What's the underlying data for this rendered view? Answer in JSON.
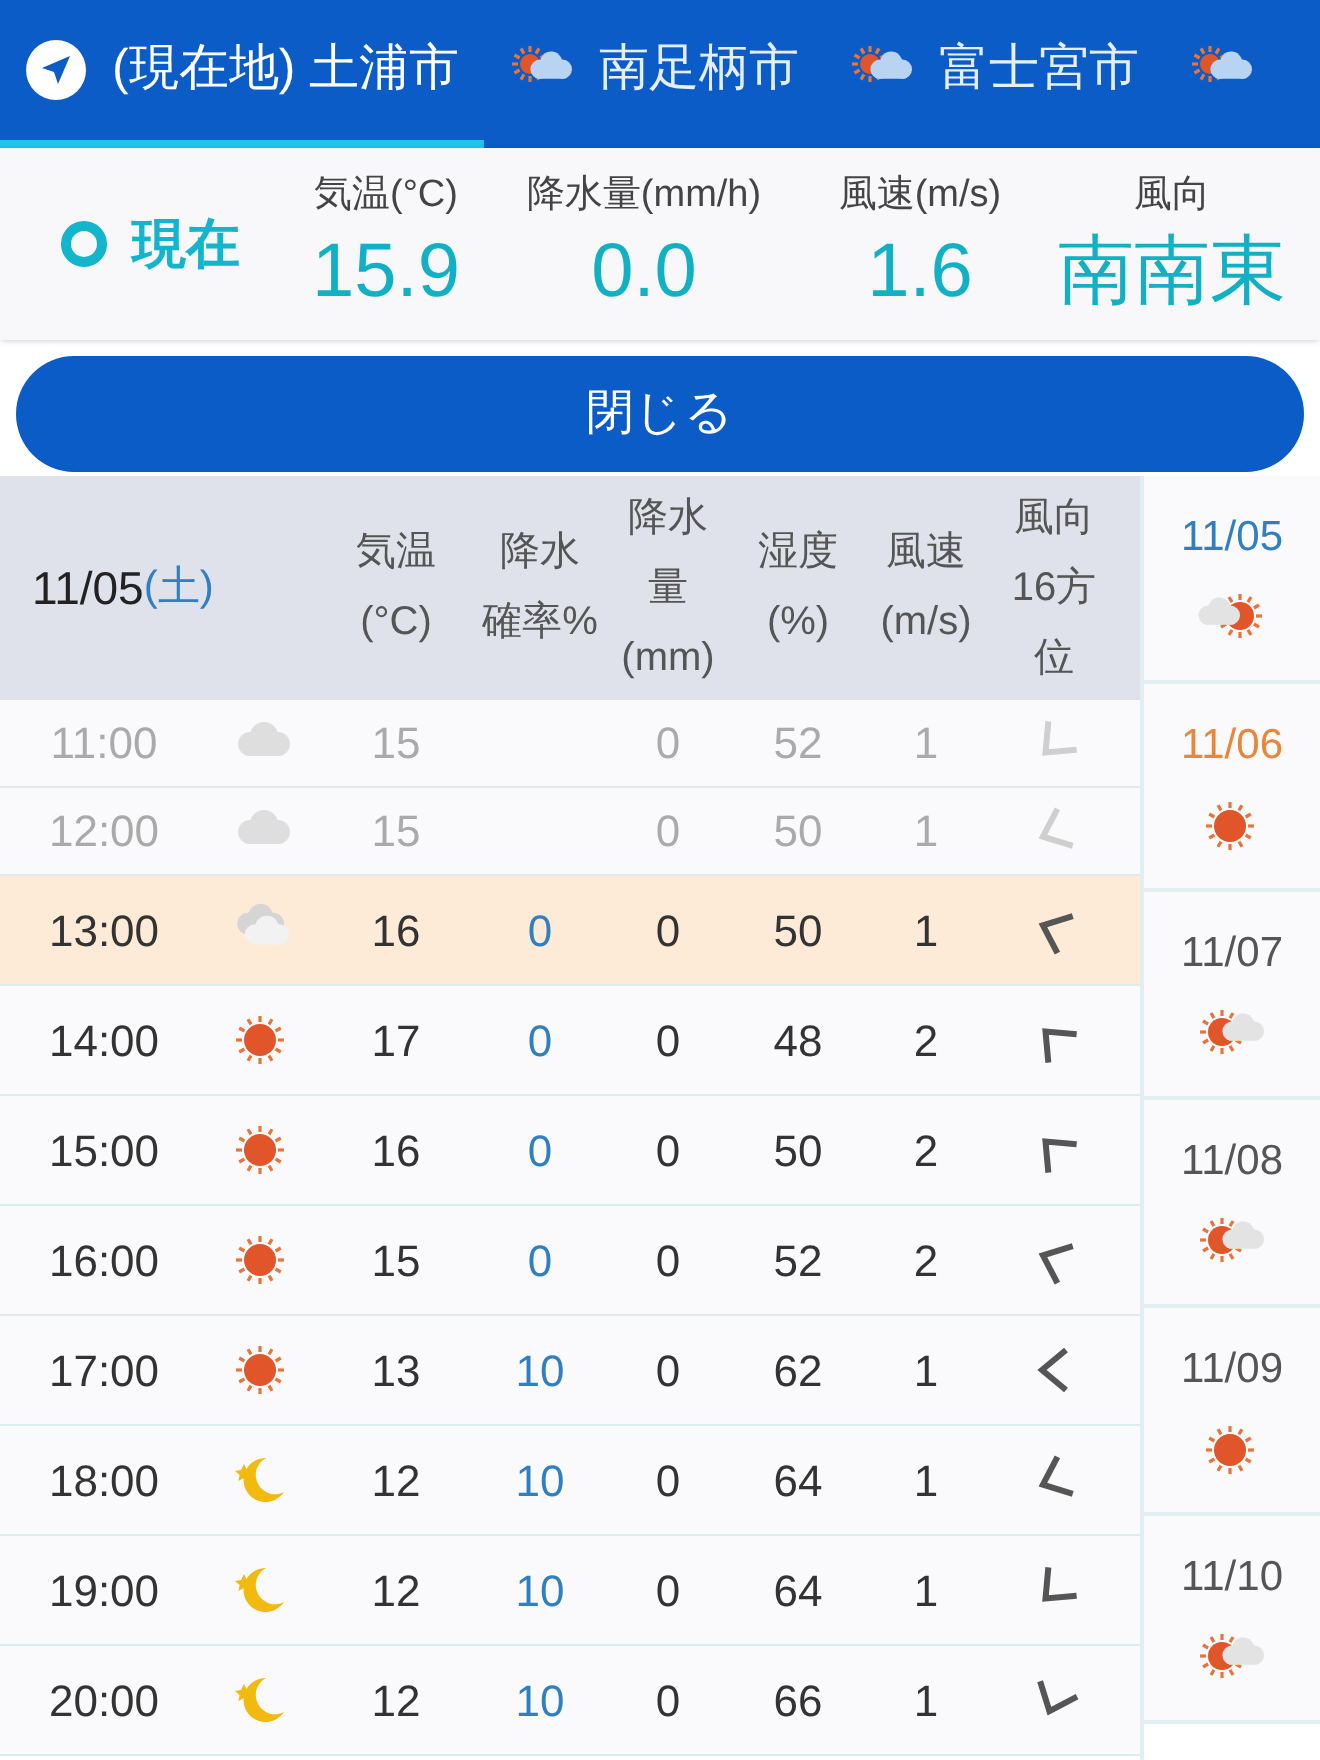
{
  "tabs": [
    {
      "label": "(現在地) 土浦市",
      "kind": "location",
      "selected": true
    },
    {
      "label": "南足柄市",
      "kind": "forecast",
      "selected": false
    },
    {
      "label": "富士宮市",
      "kind": "forecast",
      "selected": false
    },
    {
      "kind": "forecast",
      "selected": false
    }
  ],
  "current": {
    "label": "現在",
    "stats": [
      {
        "label": "気温(°C)",
        "value": "15.9"
      },
      {
        "label": "降水量(mm/h)",
        "value": "0.0"
      },
      {
        "label": "風速(m/s)",
        "value": "1.6"
      },
      {
        "label": "風向",
        "value": "南南東"
      }
    ]
  },
  "close_button": "閉じる",
  "table": {
    "date": "11/05",
    "weekday": "(土)",
    "columns": [
      "気温\n(°C)",
      "降水確率%",
      "降水量\n(mm)",
      "湿度\n(%)",
      "風速\n(m/s)",
      "風向16方位"
    ],
    "rows": [
      {
        "time": "11:00",
        "kind": "cloudy",
        "temp": "15",
        "prob": "",
        "amount": "0",
        "humidity": "52",
        "wind_speed": "1",
        "wind_icon": {
          "kind": "sw"
        },
        "past": true,
        "selected": false
      },
      {
        "time": "12:00",
        "kind": "cloudy",
        "temp": "15",
        "prob": "",
        "amount": "0",
        "humidity": "50",
        "wind_speed": "1",
        "wind_icon": {
          "kind": "wsw"
        },
        "past": true,
        "selected": false
      },
      {
        "time": "13:00",
        "kind": "overcast",
        "temp": "16",
        "prob": "0",
        "amount": "0",
        "humidity": "50",
        "wind_speed": "1",
        "wind_icon": {
          "kind": "wnw"
        },
        "past": false,
        "selected": true
      },
      {
        "time": "14:00",
        "kind": "sunny",
        "temp": "17",
        "prob": "0",
        "amount": "0",
        "humidity": "48",
        "wind_speed": "2",
        "wind_icon": {
          "kind": "nw"
        },
        "past": false,
        "selected": false
      },
      {
        "time": "15:00",
        "kind": "sunny",
        "temp": "16",
        "prob": "0",
        "amount": "0",
        "humidity": "50",
        "wind_speed": "2",
        "wind_icon": {
          "kind": "nw"
        },
        "past": false,
        "selected": false
      },
      {
        "time": "16:00",
        "kind": "sunny",
        "temp": "15",
        "prob": "0",
        "amount": "0",
        "humidity": "52",
        "wind_speed": "2",
        "wind_icon": {
          "kind": "wnw"
        },
        "past": false,
        "selected": false
      },
      {
        "time": "17:00",
        "kind": "sunny",
        "temp": "13",
        "prob": "10",
        "amount": "0",
        "humidity": "62",
        "wind_speed": "1",
        "wind_icon": {
          "kind": "w"
        },
        "past": false,
        "selected": false
      },
      {
        "time": "18:00",
        "kind": "night",
        "temp": "12",
        "prob": "10",
        "amount": "0",
        "humidity": "64",
        "wind_speed": "1",
        "wind_icon": {
          "kind": "wsw"
        },
        "past": false,
        "selected": false
      },
      {
        "time": "19:00",
        "kind": "night",
        "temp": "12",
        "prob": "10",
        "amount": "0",
        "humidity": "64",
        "wind_speed": "1",
        "wind_icon": {
          "kind": "sw"
        },
        "past": false,
        "selected": false
      },
      {
        "time": "20:00",
        "kind": "night",
        "temp": "12",
        "prob": "10",
        "amount": "0",
        "humidity": "66",
        "wind_speed": "1",
        "wind_icon": {
          "kind": "ssw"
        },
        "past": false,
        "selected": false
      }
    ]
  },
  "days": [
    {
      "date": "11/05",
      "kind": "cloudsun",
      "color": "#2f7fc1"
    },
    {
      "date": "11/06",
      "kind": "sunny",
      "color": "#e8863a"
    },
    {
      "date": "11/07",
      "kind": "suncloud",
      "color": "#555555"
    },
    {
      "date": "11/08",
      "kind": "suncloud",
      "color": "#555555"
    },
    {
      "date": "11/09",
      "kind": "sunny",
      "color": "#555555"
    },
    {
      "date": "11/10",
      "kind": "suncloud",
      "color": "#555555"
    }
  ]
}
